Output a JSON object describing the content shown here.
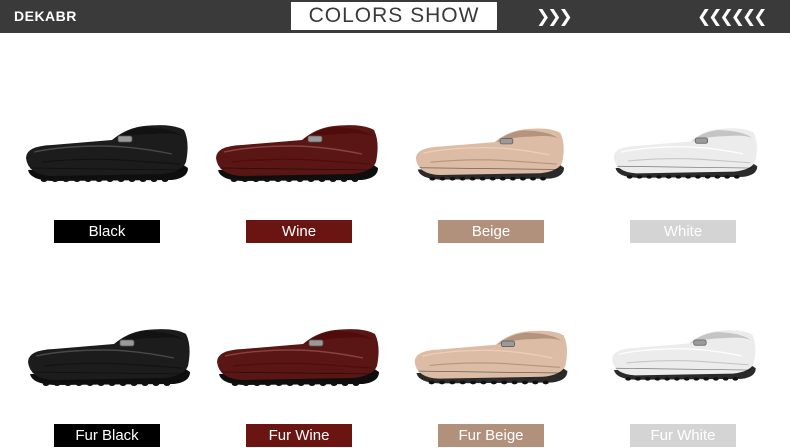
{
  "header": {
    "brand": "DEKABR",
    "title": "COLORS SHOW",
    "arrows_right": "❯❯❯",
    "arrows_left": "❮❮❮❮❮❮"
  },
  "colors": {
    "header_bg": "#3a3a3a",
    "black": "#000000",
    "wine": "#6b1512",
    "beige": "#b2917c",
    "white": "#d4d4d4"
  },
  "variants": [
    {
      "label": "Black",
      "shoe_color": "#1c1c1c",
      "label_bg": "#000000"
    },
    {
      "label": "Wine",
      "shoe_color": "#5a1614",
      "label_bg": "#6b1512"
    },
    {
      "label": "Beige",
      "shoe_color": "#dcbca4",
      "label_bg": "#b2917c"
    },
    {
      "label": "White",
      "shoe_color": "#ececec",
      "label_bg": "#d4d4d4"
    },
    {
      "label": "Fur Black",
      "shoe_color": "#1c1c1c",
      "label_bg": "#000000"
    },
    {
      "label": "Fur Wine",
      "shoe_color": "#5a1614",
      "label_bg": "#6b1512"
    },
    {
      "label": "Fur Beige",
      "shoe_color": "#dcbca4",
      "label_bg": "#b2917c"
    },
    {
      "label": "Fur White",
      "shoe_color": "#ececec",
      "label_bg": "#d4d4d4"
    }
  ]
}
